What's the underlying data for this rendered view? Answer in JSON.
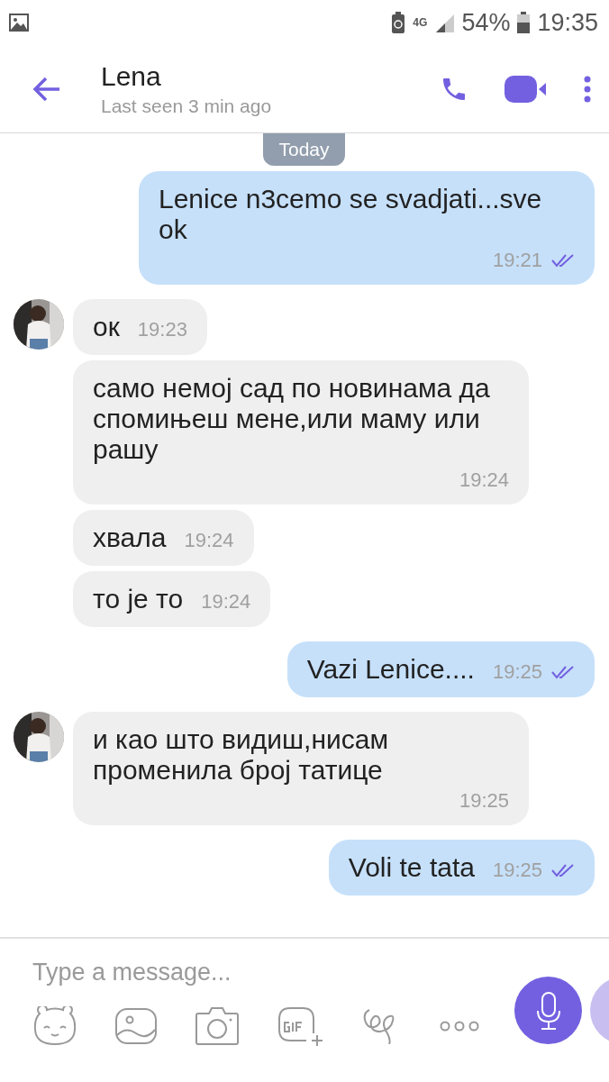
{
  "status_bar": {
    "network": "4G",
    "battery": "54%",
    "time": "19:35"
  },
  "header": {
    "name": "Lena",
    "subtitle": "Last seen 3 min ago"
  },
  "date_badge": "Today",
  "messages": [
    {
      "kind": "outgoing",
      "text": "Lenice n3cemo se svadjati...sve ok",
      "time": "19:21",
      "read": true
    },
    {
      "kind": "incoming",
      "avatar": true,
      "text": "ок",
      "time": "19:23"
    },
    {
      "kind": "incoming",
      "avatar": false,
      "text": "само немој сад по новинама да спомињеш мене,или маму или рашу",
      "time": "19:24"
    },
    {
      "kind": "incoming",
      "avatar": false,
      "text": "хвала",
      "time": "19:24"
    },
    {
      "kind": "incoming",
      "avatar": false,
      "text": "то је то",
      "time": "19:24"
    },
    {
      "kind": "outgoing",
      "text": "Vazi Lenice....",
      "time": "19:25",
      "read": true
    },
    {
      "kind": "incoming",
      "avatar": true,
      "text": "и као што видиш,нисам променила број татице",
      "time": "19:25"
    },
    {
      "kind": "outgoing",
      "text": "Voli te tata",
      "time": "19:25",
      "read": true
    }
  ],
  "composer": {
    "placeholder": "Type a message..."
  }
}
